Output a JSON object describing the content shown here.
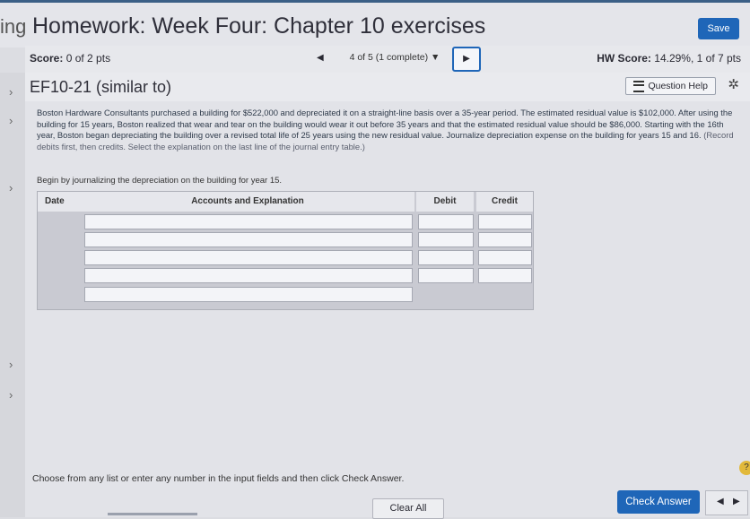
{
  "header": {
    "brand_fragment": "ing",
    "title": "Homework: Week Four: Chapter 10 exercises",
    "save_label": "Save"
  },
  "scorebar": {
    "score_label": "Score:",
    "score_value": "0 of 2 pts",
    "question_selector": "4 of 5 (1 complete)",
    "hw_score_label": "HW Score:",
    "hw_score_value": "14.29%, 1 of 7 pts"
  },
  "question": {
    "title": "EF10-21 (similar to)",
    "help_label": "Question Help",
    "prompt": "Boston Hardware Consultants purchased a building for $522,000 and depreciated it on a straight-line basis over a 35-year period. The estimated residual value is $102,000. After using the building for 15 years, Boston realized that wear and tear on the building would wear it out before 35 years and that the estimated residual value should be $86,000. Starting with the 16th year, Boston began depreciating the building over a revised total life of 25 years using the new residual value. Journalize depreciation expense on the building for years 15 and 16.",
    "prompt_note": "(Record debits first, then credits. Select the explanation on the last line of the journal entry table.)",
    "begin_text": "Begin by journalizing the depreciation on the building for year 15."
  },
  "journal": {
    "col_date": "Date",
    "col_accounts": "Accounts and Explanation",
    "col_debit": "Debit",
    "col_credit": "Credit",
    "row_count": 5
  },
  "footer": {
    "instruction": "Choose from any list or enter any number in the input fields and then click Check Answer.",
    "clear_label": "Clear All",
    "check_label": "Check Answer"
  },
  "icons": {
    "prev": "triangle-left-icon",
    "next": "triangle-right-icon",
    "dropdown": "caret-down-icon",
    "help_list": "list-icon",
    "settings": "gear-icon",
    "sidebar": "chevron-right-icon",
    "help_bubble": "question-icon"
  },
  "colors": {
    "accent": "#1f66b8",
    "header_rule": "#3b5f86"
  }
}
